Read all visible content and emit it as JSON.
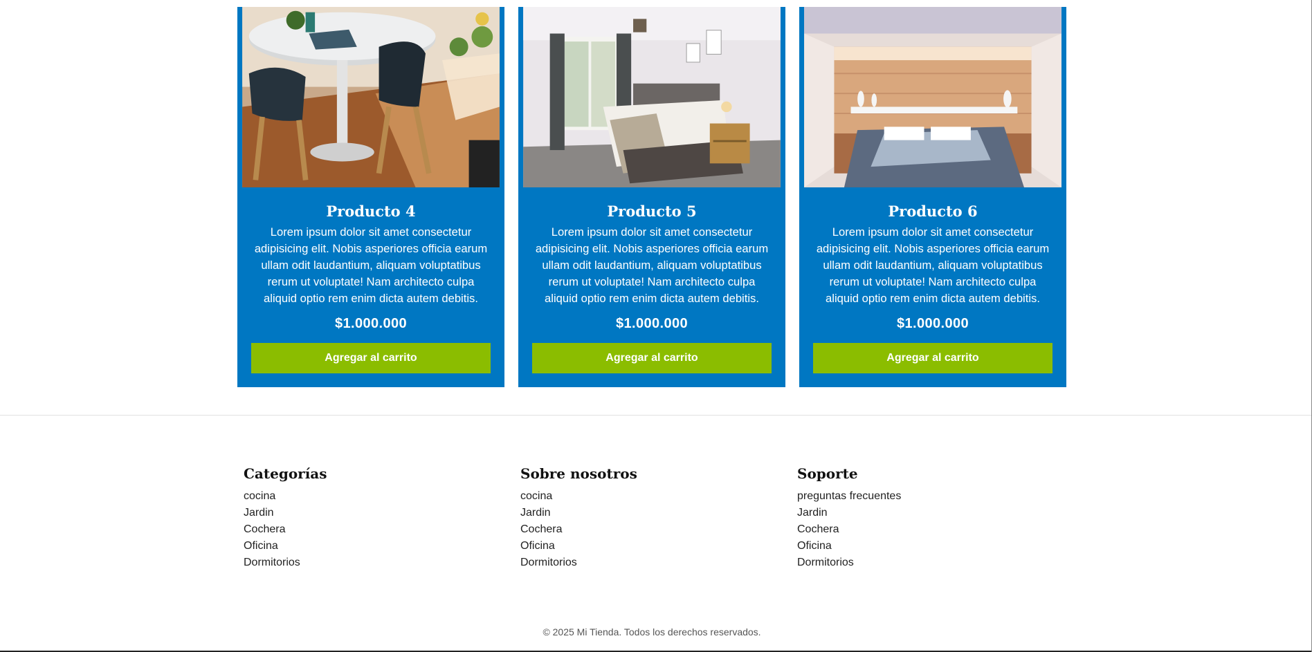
{
  "products": [
    {
      "name": "Producto 4",
      "description": "Lorem ipsum dolor sit amet consectetur adipisicing elit. Nobis asperiores officia earum ullam odit laudantium, aliquam voluptatibus rerum ut voluptate! Nam architecto culpa aliquid optio rem enim dicta autem debitis.",
      "price": "$1.000.000",
      "button_label": "Agregar al carrito"
    },
    {
      "name": "Producto 5",
      "description": "Lorem ipsum dolor sit amet consectetur adipisicing elit. Nobis asperiores officia earum ullam odit laudantium, aliquam voluptatibus rerum ut voluptate! Nam architecto culpa aliquid optio rem enim dicta autem debitis.",
      "price": "$1.000.000",
      "button_label": "Agregar al carrito"
    },
    {
      "name": "Producto 6",
      "description": "Lorem ipsum dolor sit amet consectetur adipisicing elit. Nobis asperiores officia earum ullam odit laudantium, aliquam voluptatibus rerum ut voluptate! Nam architecto culpa aliquid optio rem enim dicta autem debitis.",
      "price": "$1.000.000",
      "button_label": "Agregar al carrito"
    }
  ],
  "footer": {
    "columns": [
      {
        "title": "Categorías",
        "links": [
          "cocina",
          "Jardin",
          "Cochera",
          "Oficina",
          "Dormitorios"
        ]
      },
      {
        "title": "Sobre nosotros",
        "links": [
          "cocina",
          "Jardin",
          "Cochera",
          "Oficina",
          "Dormitorios"
        ]
      },
      {
        "title": "Soporte",
        "links": [
          "preguntas frecuentes",
          "Jardin",
          "Cochera",
          "Oficina",
          "Dormitorios"
        ]
      }
    ],
    "copyright": "© 2025 Mi Tienda. Todos los derechos reservados."
  },
  "colors": {
    "card_background": "#0077c2",
    "button_background": "#8bbd00",
    "text_on_card": "#ffffff"
  }
}
